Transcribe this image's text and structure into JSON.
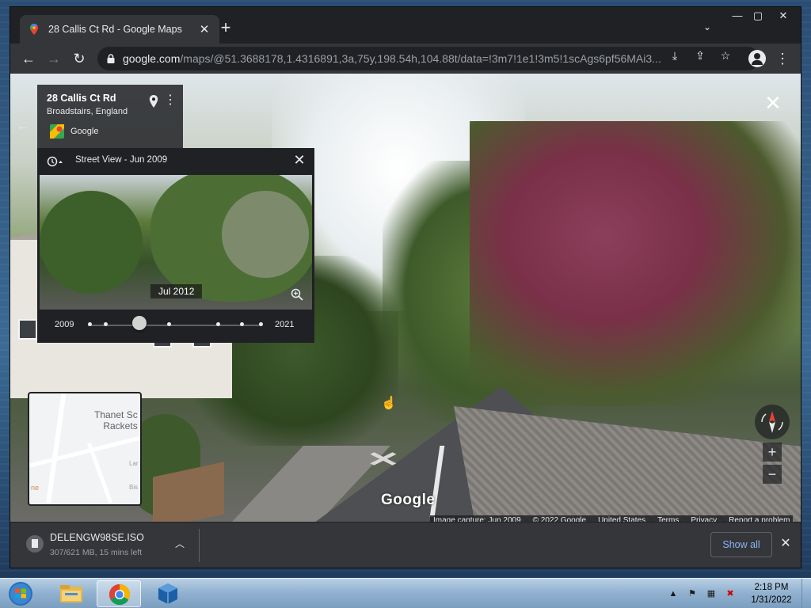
{
  "browser": {
    "tab": {
      "title": "28 Callis Ct Rd - Google Maps",
      "favicon": "google-maps-pin-icon"
    },
    "omnibox": {
      "host": "google.com",
      "path": "/maps/@51.3688178,1.4316891,3a,75y,198.54h,104.88t/data=!3m7!1e1!3m5!1scAgs6pf56MAi3..."
    },
    "window_controls": [
      "minimize",
      "maximize",
      "close"
    ]
  },
  "place_card": {
    "title": "28 Callis Ct Rd",
    "subtitle": "Broadstairs, England",
    "provider": "Google"
  },
  "time_machine": {
    "header": "Street View - Jun 2009",
    "preview_date": "Jul 2012",
    "year_start": "2009",
    "year_end": "2021",
    "selected_index": 2
  },
  "street_view": {
    "watermark": "Google"
  },
  "minimap": {
    "label": "Thanet Sc\nRackets",
    "small_labels": [
      "Lar",
      "Bis",
      "ne"
    ]
  },
  "attribution": {
    "items": [
      "Image capture: Jun 2009",
      "© 2022 Google",
      "United States",
      "Terms",
      "Privacy",
      "Report a problem"
    ]
  },
  "download": {
    "filename": "DELENGW98SE.ISO",
    "status": "307/621 MB, 15 mins left",
    "show_all": "Show all"
  },
  "taskbar": {
    "apps": [
      "windows-explorer-icon",
      "chrome-icon",
      "virtualbox-icon"
    ],
    "time": "2:18 PM",
    "date": "1/31/2022"
  },
  "colors": {
    "chrome_dark": "#202124",
    "chrome_toolbar": "#35363a",
    "link_blue": "#8ab4f8"
  }
}
